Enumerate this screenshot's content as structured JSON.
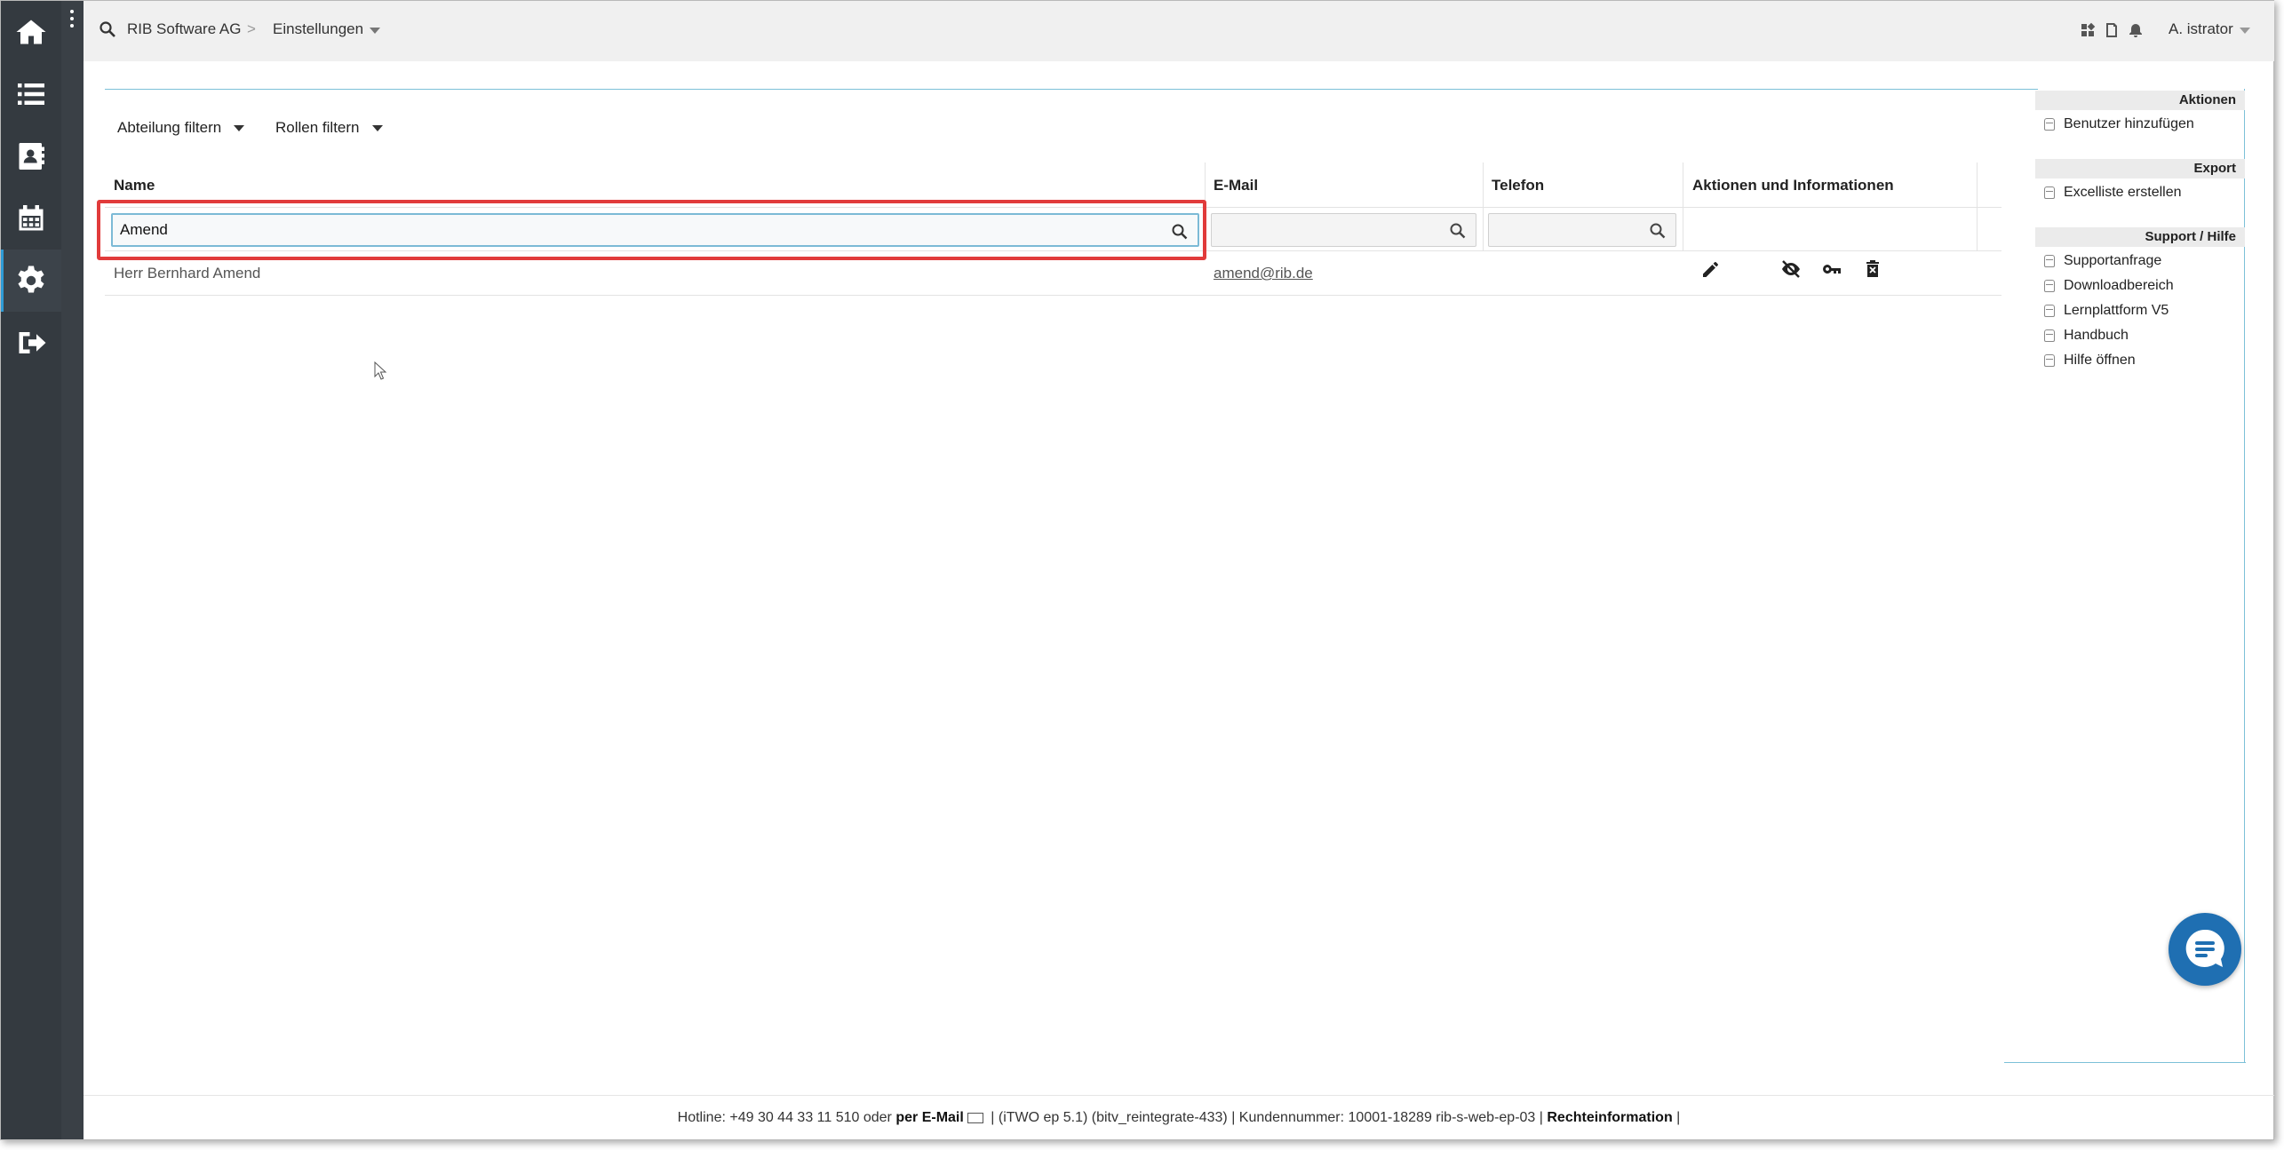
{
  "nav": {
    "items": [
      "home-icon",
      "list-icon",
      "contact-card-icon",
      "calendar-icon",
      "gear-icon",
      "logout-icon"
    ],
    "active": "gear-icon"
  },
  "topbar": {
    "org": "RIB Software AG",
    "separator": ">",
    "section": "Einstellungen",
    "user": "A. istrator"
  },
  "filters": {
    "department": "Abteilung filtern",
    "roles": "Rollen filtern"
  },
  "table": {
    "columns": [
      "Name",
      "E-Mail",
      "Telefon",
      "Aktionen und Informationen"
    ],
    "search": {
      "name_value": "Amend",
      "email_value": "",
      "phone_value": ""
    },
    "rows": [
      {
        "name": "Herr Bernhard Amend",
        "email": "amend@rib.de",
        "phone": ""
      }
    ]
  },
  "sidebar": {
    "sections": [
      {
        "title": "Aktionen",
        "items": [
          "Benutzer hinzufügen"
        ]
      },
      {
        "title": "Export",
        "items": [
          "Excelliste erstellen"
        ]
      },
      {
        "title": "Support / Hilfe",
        "items": [
          "Supportanfrage",
          "Downloadbereich",
          "Lernplattform V5",
          "Handbuch",
          "Hilfe öffnen"
        ]
      }
    ]
  },
  "footer": {
    "hotline": "Hotline: +49 30 44 33 11 510 oder",
    "email_link": "per E-Mail",
    "version": "|  (iTWO ep 5.1) (bitv_reintegrate-433)  |  Kundennummer: 10001-18289 rib-s-web-ep-03 |",
    "legal": "Rechteinformation",
    "end": "|"
  },
  "colors": {
    "nav_bg": "#343a40",
    "accent": "#7cc0d8",
    "highlight": "#e13b3b",
    "chat": "#1f6fb2"
  }
}
